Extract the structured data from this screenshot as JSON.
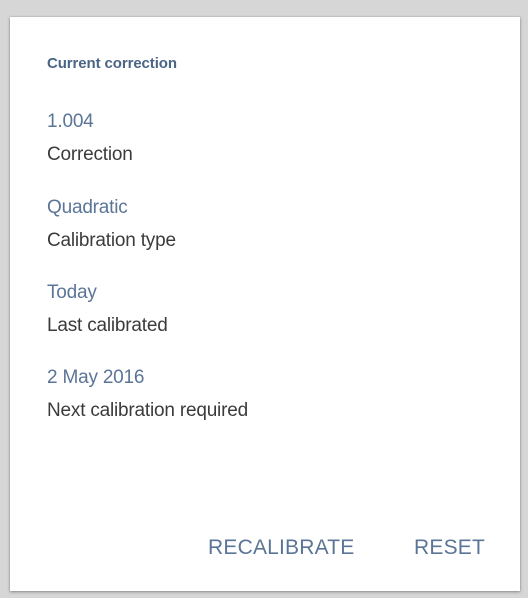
{
  "card": {
    "title": "Current correction",
    "fields": [
      {
        "value": "1.004",
        "label": "Correction"
      },
      {
        "value": "Quadratic",
        "label": "Calibration type"
      },
      {
        "value": "Today",
        "label": "Last calibrated"
      },
      {
        "value": "2 May 2016",
        "label": "Next calibration required"
      }
    ],
    "actions": {
      "recalibrate_label": "RECALIBRATE",
      "reset_label": "RESET"
    }
  },
  "colors": {
    "accent": "#5b7597",
    "title": "#4a6585",
    "text": "#3b3b3b",
    "background": "#d6d6d6",
    "card": "#ffffff"
  }
}
